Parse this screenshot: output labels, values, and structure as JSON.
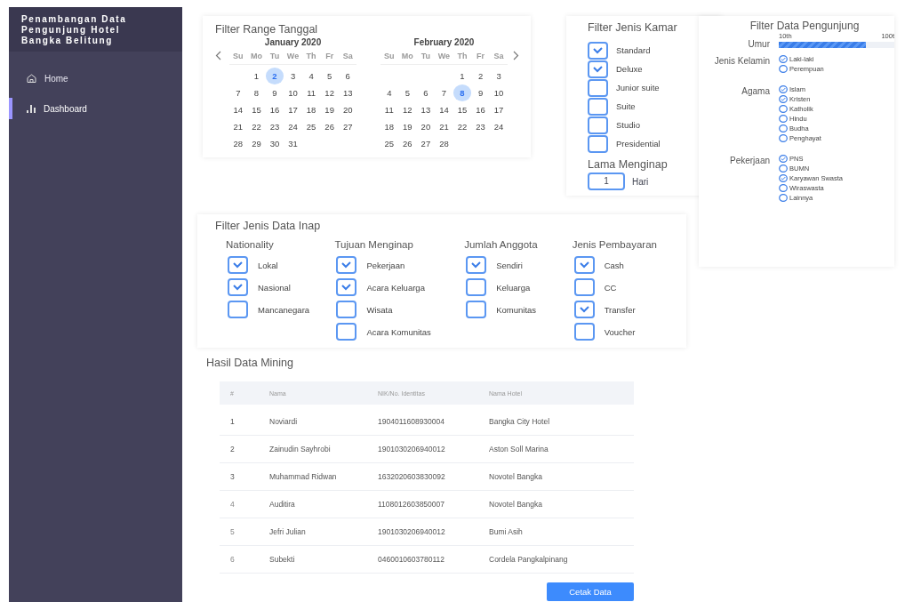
{
  "sidebar": {
    "title": "Penambangan Data Pengunjung Hotel Bangka Belitung",
    "items": [
      {
        "label": "Home",
        "kind": "home",
        "selected": false
      },
      {
        "label": "Dashboard",
        "kind": "chart",
        "selected": true
      }
    ]
  },
  "date_filter": {
    "title": "Filter Range Tanggal",
    "months": [
      {
        "title": "January 2020",
        "weekdays": [
          "Su",
          "Mo",
          "Tu",
          "We",
          "Th",
          "Fr",
          "Sa"
        ],
        "weeks": [
          [
            {
              "d": "1",
              "selected": false
            },
            {
              "d": "2",
              "selected": true
            },
            {
              "d": "3",
              "selected": false
            },
            {
              "d": "4",
              "selected": false
            },
            {
              "d": "5",
              "selected": false
            },
            {
              "d": "6",
              "selected": false
            }
          ],
          [
            {
              "d": "7",
              "selected": false
            },
            {
              "d": "8",
              "selected": false
            },
            {
              "d": "9",
              "selected": false
            },
            {
              "d": "10",
              "selected": false
            },
            {
              "d": "11",
              "selected": false
            },
            {
              "d": "12",
              "selected": false
            },
            {
              "d": "13",
              "selected": false
            }
          ],
          [
            {
              "d": "14",
              "selected": false
            },
            {
              "d": "15",
              "selected": false
            },
            {
              "d": "16",
              "selected": false
            },
            {
              "d": "17",
              "selected": false
            },
            {
              "d": "18",
              "selected": false
            },
            {
              "d": "19",
              "selected": false
            },
            {
              "d": "20",
              "selected": false
            }
          ],
          [
            {
              "d": "21",
              "selected": false
            },
            {
              "d": "22",
              "selected": false
            },
            {
              "d": "23",
              "selected": false
            },
            {
              "d": "24",
              "selected": false
            },
            {
              "d": "25",
              "selected": false
            },
            {
              "d": "26",
              "selected": false
            },
            {
              "d": "27",
              "selected": false
            }
          ],
          [
            {
              "d": "28",
              "selected": false
            },
            {
              "d": "29",
              "selected": false
            },
            {
              "d": "30",
              "selected": false
            },
            {
              "d": "31",
              "selected": false
            }
          ]
        ]
      },
      {
        "title": "February 2020",
        "weekdays": [
          "Su",
          "Mo",
          "Tu",
          "We",
          "Th",
          "Fr",
          "Sa"
        ],
        "weeks": [
          [
            {
              "d": "1",
              "selected": false
            },
            {
              "d": "2",
              "selected": false
            },
            {
              "d": "3",
              "selected": false
            }
          ],
          [
            {
              "d": "4",
              "selected": false
            },
            {
              "d": "5",
              "selected": false
            },
            {
              "d": "6",
              "selected": false
            },
            {
              "d": "7",
              "selected": false
            },
            {
              "d": "8",
              "selected": true
            },
            {
              "d": "9",
              "selected": false
            },
            {
              "d": "10",
              "selected": false
            }
          ],
          [
            {
              "d": "11",
              "selected": false
            },
            {
              "d": "12",
              "selected": false
            },
            {
              "d": "13",
              "selected": false
            },
            {
              "d": "14",
              "selected": false
            },
            {
              "d": "15",
              "selected": false
            },
            {
              "d": "16",
              "selected": false
            },
            {
              "d": "17",
              "selected": false
            }
          ],
          [
            {
              "d": "18",
              "selected": false
            },
            {
              "d": "19",
              "selected": false
            },
            {
              "d": "20",
              "selected": false
            },
            {
              "d": "21",
              "selected": false
            },
            {
              "d": "22",
              "selected": false
            },
            {
              "d": "23",
              "selected": false
            },
            {
              "d": "24",
              "selected": false
            }
          ],
          [
            {
              "d": "25",
              "selected": false
            },
            {
              "d": "26",
              "selected": false
            },
            {
              "d": "27",
              "selected": false
            },
            {
              "d": "28",
              "selected": false
            }
          ]
        ]
      }
    ]
  },
  "room_filter": {
    "title": "Filter Jenis Kamar",
    "options": [
      {
        "label": "Standard",
        "checked": true
      },
      {
        "label": "Deluxe",
        "checked": true
      },
      {
        "label": "Junior suite",
        "checked": false
      },
      {
        "label": "Suite",
        "checked": false
      },
      {
        "label": "Studio",
        "checked": false
      },
      {
        "label": "Presidential",
        "checked": false
      }
    ],
    "stay": {
      "label": "Lama Menginap",
      "value": "1",
      "unit": "Hari"
    }
  },
  "visitor_filter": {
    "title": "Filter Data Pengunjung",
    "age": {
      "label": "Umur",
      "min": "10th",
      "max": "100t",
      "level": 0.75
    },
    "groups": [
      {
        "label": "Jenis Kelamin",
        "options": [
          {
            "label": "Laki-laki",
            "checked": true
          },
          {
            "label": "Perempuan",
            "checked": false
          }
        ]
      },
      {
        "label": "Agama",
        "options": [
          {
            "label": "Islam",
            "checked": true
          },
          {
            "label": "Kristen",
            "checked": true
          },
          {
            "label": "Katholik",
            "checked": false
          },
          {
            "label": "Hindu",
            "checked": false
          },
          {
            "label": "Budha",
            "checked": false
          },
          {
            "label": "Penghayat",
            "checked": false
          }
        ]
      },
      {
        "label": "Pekerjaan",
        "options": [
          {
            "label": "PNS",
            "checked": true
          },
          {
            "label": "BUMN",
            "checked": false
          },
          {
            "label": "Karyawan Swasta",
            "checked": true
          },
          {
            "label": "Wiraswasta",
            "checked": false
          },
          {
            "label": "Lainnya",
            "checked": false
          }
        ]
      }
    ]
  },
  "stay_filter": {
    "title": "Filter Jenis Data Inap",
    "groups": [
      {
        "label": "Nationality",
        "options": [
          {
            "label": "Lokal",
            "checked": true
          },
          {
            "label": "Nasional",
            "checked": true
          },
          {
            "label": "Mancanegara",
            "checked": false
          }
        ]
      },
      {
        "label": "Tujuan Menginap",
        "options": [
          {
            "label": "Pekerjaan",
            "checked": true
          },
          {
            "label": "Acara Keluarga",
            "checked": true
          },
          {
            "label": "Wisata",
            "checked": false
          },
          {
            "label": "Acara Komunitas",
            "checked": false
          }
        ]
      },
      {
        "label": "Jumlah Anggota",
        "options": [
          {
            "label": "Sendiri",
            "checked": true
          },
          {
            "label": "Keluarga",
            "checked": false
          },
          {
            "label": "Komunitas",
            "checked": false
          }
        ]
      },
      {
        "label": "Jenis Pembayaran",
        "options": [
          {
            "label": "Cash",
            "checked": true
          },
          {
            "label": "CC",
            "checked": false
          },
          {
            "label": "Transfer",
            "checked": true
          },
          {
            "label": "Voucher",
            "checked": false
          }
        ]
      }
    ]
  },
  "results": {
    "title": "Hasil Data Mining",
    "table": {
      "columns": [
        "#",
        "Nama",
        "NIK/No. Identitas",
        "Nama Hotel"
      ],
      "rows": [
        [
          "1",
          "Noviardi",
          "1904011608930004",
          "Bangka City Hotel"
        ],
        [
          "2",
          "Zainudin Sayhrobi",
          "1901030206940012",
          "Aston Soll Marina"
        ],
        [
          "3",
          "Muhammad Ridwan",
          "1632020603830092",
          "Novotel Bangka"
        ],
        [
          "4",
          "Auditira",
          "1108012603850007",
          "Novotel Bangka"
        ],
        [
          "5",
          "Jefri Julian",
          "1901030206940012",
          "Bumi Asih"
        ],
        [
          "6",
          "Subekti",
          "0460010603780112",
          "Cordela Pangkalpinang"
        ]
      ]
    },
    "button": "Cetak Data"
  }
}
